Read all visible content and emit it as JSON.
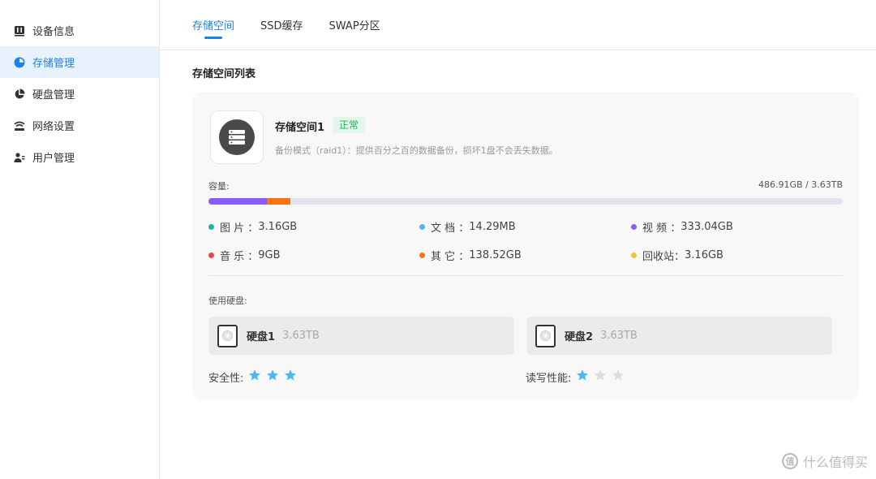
{
  "sidebar": {
    "items": [
      {
        "label": "设备信息",
        "icon": "device-icon",
        "active": false
      },
      {
        "label": "存储管理",
        "icon": "storage-icon",
        "active": true
      },
      {
        "label": "硬盘管理",
        "icon": "disk-chart-icon",
        "active": false
      },
      {
        "label": "网络设置",
        "icon": "network-icon",
        "active": false
      },
      {
        "label": "用户管理",
        "icon": "users-icon",
        "active": false
      }
    ]
  },
  "tabs": [
    {
      "label": "存储空间",
      "active": true
    },
    {
      "label": "SSD缓存",
      "active": false
    },
    {
      "label": "SWAP分区",
      "active": false
    }
  ],
  "section_title": "存储空间列表",
  "pool": {
    "name": "存储空间1",
    "status": "正常",
    "description": "备份模式（raid1）：提供百分之百的数据备份，损坏1盘不会丢失数据。",
    "capacity_label": "容量:",
    "capacity_value": "486.91GB / 3.63TB",
    "capacity_segments": [
      {
        "color": "#8b5cf6",
        "fraction": 0.092
      },
      {
        "color": "#f97316",
        "fraction": 0.037
      }
    ],
    "legend": [
      {
        "label": "图  片",
        "value": "3.16GB",
        "color": "#1cb6a8"
      },
      {
        "label": "文  档",
        "value": "14.29MB",
        "color": "#4cb8f0"
      },
      {
        "label": "视  频",
        "value": "333.04GB",
        "color": "#8b5cf6"
      },
      {
        "label": "音  乐",
        "value": "9GB",
        "color": "#f04444"
      },
      {
        "label": "其  它",
        "value": "138.52GB",
        "color": "#f97316"
      },
      {
        "label": "回收站",
        "value": "3.16GB",
        "color": "#f5c33b"
      }
    ],
    "disks_label": "使用硬盘:",
    "disks": [
      {
        "name": "硬盘1",
        "size": "3.63TB"
      },
      {
        "name": "硬盘2",
        "size": "3.63TB"
      }
    ],
    "safety": {
      "label": "安全性:",
      "stars": 3,
      "max": 3
    },
    "performance": {
      "label": "读写性能:",
      "stars": 1,
      "max": 3
    },
    "star_on_color": "#4cb8f0",
    "star_off_color": "#dddddd"
  },
  "watermark": {
    "text": "什么值得买",
    "icon_text": "值"
  }
}
